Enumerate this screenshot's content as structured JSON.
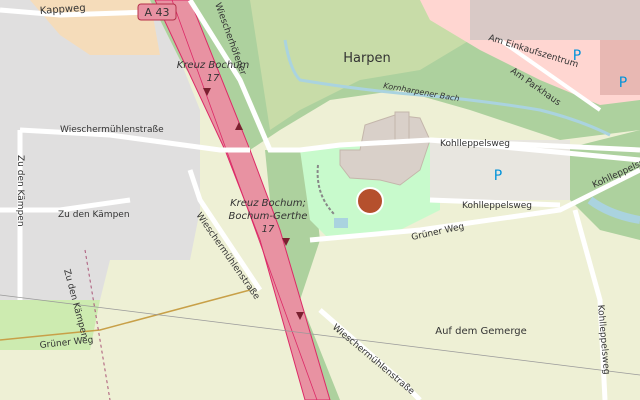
{
  "map": {
    "motorway_ref": "A 43",
    "places": {
      "harpen": "Harpen",
      "auf_dem_gemerge": "Auf dem Gemerge"
    },
    "junctions": {
      "kreuz_bochum_name": "Kreuz Bochum",
      "kreuz_bochum_number": "17",
      "bochum_gerthe_name_1": "Kreuz Bochum;",
      "bochum_gerthe_name_2": "Bochum-Gerthe",
      "bochum_gerthe_number": "17"
    },
    "streets": {
      "kappweg": "Kappweg",
      "wiescherhoefener": "Wiescherhöfener",
      "am_einkaufszentrum": "Am Einkaufszentrum",
      "am_parkhaus": "Am Parkhaus",
      "kornharpener_bach": "Kornharpener Bach",
      "kohlleppelsweg_top": "Kohlleppelsweg",
      "kohlleppelsweg_mid": "Kohlleppelsweg",
      "kohlleppelsweg_right": "Kohlleppelsweg",
      "kohlleppelsweg_bottom_right": "Kohlleppelsweg",
      "wieschermuehlen_1": "Wieschermühlenstraße",
      "wieschermuehlen_2": "Wieschermühlenstraße",
      "wieschermuehlen_3": "Wieschermühlenstraße",
      "zu_den_kaempen_1": "Zu den Kämpen",
      "zu_den_kaempen_2": "Zu den Kämpen",
      "zu_den_kaempen_3": "Zu den Kämpen",
      "gruener_weg_1": "Grüner Weg",
      "gruener_weg_2": "Grüner Weg"
    },
    "parking_symbol": "P",
    "colors": {
      "motorway": "#e892a2",
      "motorway_casing": "#dc2a67",
      "forest": "#add19e",
      "park": "#c8facc",
      "farmland": "#eef0d5",
      "residential": "#e0dfdf",
      "retail": "#ffd6d1",
      "water": "#aad3df",
      "building": "#d9d0c9",
      "marker": "#b5502d"
    }
  }
}
